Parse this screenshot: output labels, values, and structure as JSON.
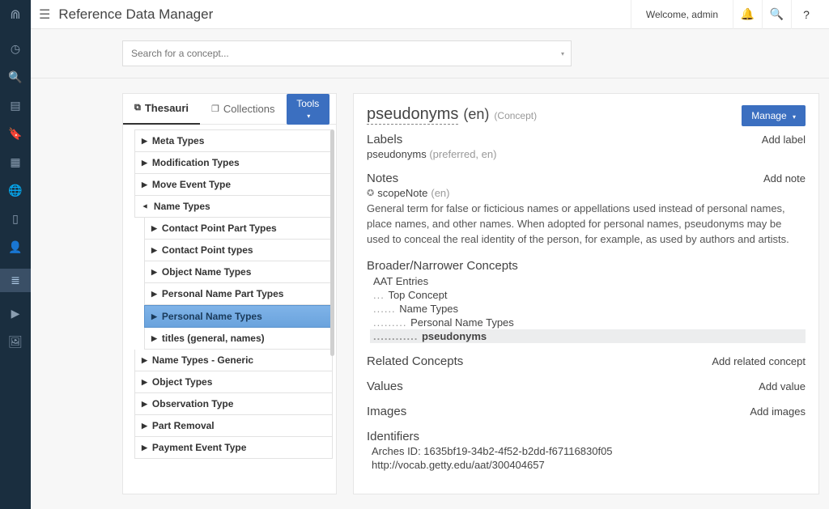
{
  "header": {
    "title": "Reference Data Manager",
    "welcome": "Welcome, admin"
  },
  "search": {
    "placeholder": "Search for a concept..."
  },
  "tabs": {
    "thesauri": "Thesauri",
    "collections": "Collections",
    "tools": "Tools"
  },
  "tree": {
    "items": [
      {
        "label": "Meta Types",
        "level": 0,
        "expanded": false
      },
      {
        "label": "Modification Types",
        "level": 0,
        "expanded": false
      },
      {
        "label": "Move Event Type",
        "level": 0,
        "expanded": false
      },
      {
        "label": "Name Types",
        "level": 0,
        "expanded": true
      },
      {
        "label": "Contact Point Part Types",
        "level": 1,
        "expanded": false
      },
      {
        "label": "Contact Point types",
        "level": 1,
        "expanded": false
      },
      {
        "label": "Object Name Types",
        "level": 1,
        "expanded": false
      },
      {
        "label": "Personal Name Part Types",
        "level": 1,
        "expanded": false
      },
      {
        "label": "Personal Name Types",
        "level": 1,
        "expanded": false,
        "selected": true
      },
      {
        "label": "titles (general, names)",
        "level": 1,
        "expanded": false
      },
      {
        "label": "Name Types - Generic",
        "level": 0,
        "expanded": false
      },
      {
        "label": "Object Types",
        "level": 0,
        "expanded": false
      },
      {
        "label": "Observation Type",
        "level": 0,
        "expanded": false
      },
      {
        "label": "Part Removal",
        "level": 0,
        "expanded": false
      },
      {
        "label": "Payment Event Type",
        "level": 0,
        "expanded": false
      }
    ]
  },
  "concept": {
    "title": "pseudonyms",
    "lang": "(en)",
    "type": "(Concept)",
    "manage": "Manage",
    "labels_title": "Labels",
    "labels_action": "Add label",
    "label_line": "pseudonyms",
    "label_meta": "(preferred, en)",
    "notes_title": "Notes",
    "notes_action": "Add note",
    "note_type": "scopeNote",
    "note_lang": "(en)",
    "note_body": "General term for false or ficticious names or appellations used instead of personal names, place names, and other names. When adopted for personal names, pseudonyms may be used to conceal the real identity of the person, for example, as used by authors and artists.",
    "hier_title": "Broader/Narrower Concepts",
    "hier_root": "AAT Entries",
    "hier_l1": "Top Concept",
    "hier_l2": "Name Types",
    "hier_l3": "Personal Name Types",
    "hier_l4": "pseudonyms",
    "related_title": "Related Concepts",
    "related_action": "Add related concept",
    "values_title": "Values",
    "values_action": "Add value",
    "images_title": "Images",
    "images_action": "Add images",
    "ids_title": "Identifiers",
    "arches_id": "Arches ID: 1635bf19-34b2-4f52-b2dd-f67116830f05",
    "ext_id": "http://vocab.getty.edu/aat/300404657"
  }
}
